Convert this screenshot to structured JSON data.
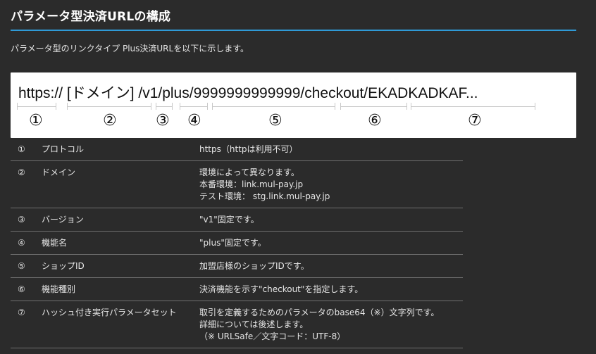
{
  "header": {
    "title": "パラメータ型決済URLの構成",
    "intro": "パラメータ型のリンクタイプ Plus決済URLを以下に示します。"
  },
  "url_example": {
    "text": "https:// [ドメイン] /v1/plus/9999999999999/checkout/EKADKADKAF...",
    "markers": [
      "①",
      "②",
      "③",
      "④",
      "⑤",
      "⑥",
      "⑦"
    ]
  },
  "table": {
    "rows": [
      {
        "num": "①",
        "label": "プロトコル",
        "desc": [
          "https（httpは利用不可）"
        ]
      },
      {
        "num": "②",
        "label": "ドメイン",
        "desc": [
          "環境によって異なります。",
          "本番環境：link.mul-pay.jp",
          "テスト環境： stg.link.mul-pay.jp"
        ]
      },
      {
        "num": "③",
        "label": "バージョン",
        "desc": [
          "\"v1\"固定です。"
        ]
      },
      {
        "num": "④",
        "label": "機能名",
        "desc": [
          "\"plus\"固定です。"
        ]
      },
      {
        "num": "⑤",
        "label": "ショップID",
        "desc": [
          "加盟店様のショップIDです。"
        ]
      },
      {
        "num": "⑥",
        "label": "機能種別",
        "desc": [
          "決済機能を示す\"checkout\"を指定します。"
        ]
      },
      {
        "num": "⑦",
        "label": "ハッシュ付き実行パラメータセット",
        "desc": [
          "取引を定義するためのパラメータのbase64（※）文字列です。",
          "詳細については後述します。",
          "（※ URLSafe／文字コード：UTF-8）"
        ]
      }
    ]
  },
  "colors": {
    "background": "#2b2b2b",
    "accent_rule": "#2f9ad6",
    "url_box": "#ffffff"
  }
}
